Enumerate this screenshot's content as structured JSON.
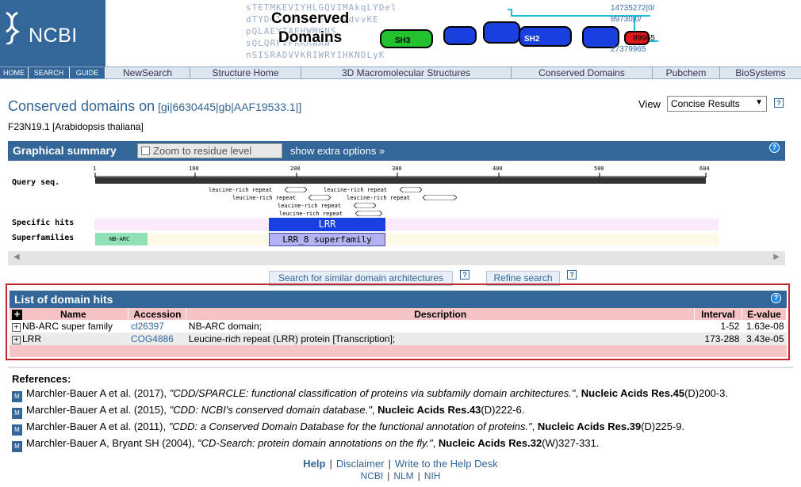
{
  "header": {
    "logo_text": "NCBI",
    "banner_title_line1": "Conserved",
    "banner_title_line2": "Domains",
    "banner_seq_lines": [
      "sTETMKEVIYHLGQVIMAkqLYDel",
      "dTYDGTTLRKLLEEGIRdvvKE",
      "pQLAEYTAEHWMKNS",
      "sQLQRFVPKRMWAW",
      "nSISRADVVKRIWRYIHKNDLyK"
    ],
    "banner_numbers": [
      "14735272|0/",
      "89730|0/",
      "89965",
      "27379965"
    ],
    "banner_domain_labels": [
      "SH3",
      "SH2"
    ]
  },
  "nav": {
    "small": [
      "HOME",
      "SEARCH",
      "GUIDE"
    ],
    "big": [
      "NewSearch",
      "Structure Home",
      "3D Macromolecular Structures",
      "Conserved Domains",
      "Pubchem",
      "BioSystems"
    ]
  },
  "title": {
    "main": "Conserved domains on",
    "gi_open": "[",
    "gi_link": "gi|6630445|gb|AAF19533.1|",
    "gi_close": "]",
    "subtitle": "F23N19.1 [Arabidopsis thaliana]",
    "view_label": "View",
    "view_value": "Concise Results"
  },
  "graphical_summary": {
    "title": "Graphical summary",
    "zoom_label": "Zoom to residue level",
    "extra_options": "show extra options »",
    "query_label": "Query seq.",
    "specific_label": "Specific hits",
    "superfam_label": "Superfamilies",
    "ticks": [
      "1",
      "100",
      "200",
      "300",
      "400",
      "500",
      "604"
    ],
    "repeat_labels": [
      "leucine-rich repeat",
      "leucine-rich repeat",
      "leucine-rich repeat",
      "leucine-rich repeat",
      "leucine-rich repeat",
      "leucine-rich repeat"
    ],
    "lrr_label": "LRR",
    "lrr8_label": "LRR_8 superfamily",
    "nbarc_label": "NB-ARC"
  },
  "buttons": {
    "similar": "Search for similar domain architectures",
    "refine": "Refine search"
  },
  "hits": {
    "title": "List of domain hits",
    "columns": [
      "Name",
      "Accession",
      "Description",
      "Interval",
      "E-value"
    ],
    "rows": [
      {
        "name": "NB-ARC super family",
        "accession": "cl26397",
        "description": "NB-ARC domain;",
        "interval": "1-52",
        "evalue": "1.63e-08"
      },
      {
        "name": "LRR",
        "accession": "COG4886",
        "description": "Leucine-rich repeat (LRR) protein [Transcription];",
        "interval": "173-288",
        "evalue": "3.43e-05"
      }
    ]
  },
  "references": {
    "title": "References:",
    "items": [
      {
        "authors": "Marchler-Bauer A et al. (2017), ",
        "title": "\"CDD/SPARCLE: functional classification of proteins via subfamily domain architectures.\"",
        "journal": "Nucleic Acids Res.45",
        "pages": "(D)200-3."
      },
      {
        "authors": "Marchler-Bauer A et al. (2015), ",
        "title": "\"CDD: NCBI's conserved domain database.\"",
        "journal": "Nucleic Acids Res.43",
        "pages": "(D)222-6."
      },
      {
        "authors": "Marchler-Bauer A et al. (2011), ",
        "title": "\"CDD: a Conserved Domain Database for the functional annotation of proteins.\"",
        "journal": "Nucleic Acids Res.39",
        "pages": "(D)225-9."
      },
      {
        "authors": "Marchler-Bauer A, Bryant SH (2004), ",
        "title": "\"CD-Search: protein domain annotations on the fly.\"",
        "journal": "Nucleic Acids Res.32",
        "pages": "(W)327-331."
      }
    ]
  },
  "footer": {
    "help": "Help",
    "disclaimer": "Disclaimer",
    "write": "Write to the Help Desk",
    "ncbi": "NCBI",
    "nlm": "NLM",
    "nih": "NIH",
    "separator": "|"
  },
  "colors": {
    "brand": "#336699",
    "lrr_domain": "#1a3fe0",
    "superfamily": "#b3b3f2",
    "nbarc": "#8fe0b4",
    "table_header": "#f6c4c4",
    "highlight_border": "#c1272d"
  }
}
